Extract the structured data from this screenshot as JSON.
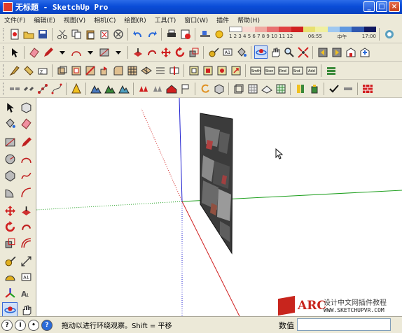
{
  "window": {
    "title": "无标题 - SketchUp Pro"
  },
  "menu": [
    {
      "label": "文件(F)"
    },
    {
      "label": "编辑(E)"
    },
    {
      "label": "视图(V)"
    },
    {
      "label": "相机(C)"
    },
    {
      "label": "绘图(R)"
    },
    {
      "label": "工具(T)"
    },
    {
      "label": "窗口(W)"
    },
    {
      "label": "插件"
    },
    {
      "label": "帮助(H)"
    }
  ],
  "sunbar": {
    "months": "1 2 3 4 5 6 7 8 9 10 11 12",
    "time_start": "06:55",
    "noon": "中午",
    "time_end": "17:00"
  },
  "status": {
    "hint": "拖动以进行环绕观察。Shift = 平移",
    "measure_label": "数值",
    "measure_value": ""
  },
  "watermark": {
    "brand": "ARC",
    "tagline": "设计中文网插件教程",
    "url": "WWW.SKETCHUPVR.COM"
  },
  "colors": {
    "titlebar": "#0a4dd8",
    "axis_red": "#d02020",
    "axis_green": "#20a020",
    "axis_blue": "#2020d0",
    "panel_face": "#3b3b3b"
  }
}
